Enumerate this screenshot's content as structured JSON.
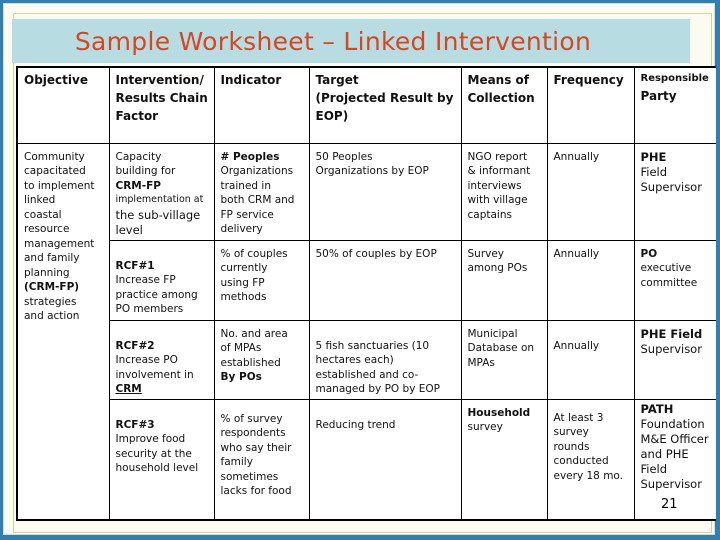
{
  "slide": {
    "title": "Sample Worksheet – Linked Intervention",
    "page_number": "21"
  },
  "table": {
    "headers": {
      "objective": "Objective",
      "intervention_l1": "Intervention/",
      "intervention_l2": "Results Chain",
      "intervention_l3": "Factor",
      "indicator": "Indicator",
      "target_l1": "Target",
      "target_l2": "(Projected Result  by",
      "target_l3": "EOP)",
      "means_l1": "Means of",
      "means_l2": "Collection",
      "frequency": "Frequency",
      "responsible_l1": "Responsible",
      "responsible_l2": "Party"
    },
    "objective": {
      "l1": "Community",
      "l2": "capacitated",
      "l3": "to implement",
      "l4": "linked",
      "l5": "coastal",
      "l6": "resource",
      "l7": "management",
      "l8": "and family",
      "l9": "planning",
      "l10": "(CRM-FP)",
      "l11": "strategies",
      "l12": "and action"
    },
    "rows": [
      {
        "intervention": {
          "l1": "Capacity",
          "l2": "building for",
          "l3": "CRM-FP",
          "l4": "implementation at",
          "l5": "the sub-village",
          "l6": "level"
        },
        "indicator": {
          "l1": "# Peoples",
          "l2": "Organizations",
          "l3": "trained in",
          "l4": "both CRM and",
          "l5": "FP service",
          "l6": "delivery"
        },
        "target": {
          "l1": "50 Peoples",
          "l2": "Organizations by EOP"
        },
        "means": {
          "l1": "NGO report",
          "l2": "& informant",
          "l3": "interviews",
          "l4": "with village",
          "l5": "captains"
        },
        "frequency": {
          "l1": "Annually"
        },
        "responsible": {
          "l1": "PHE",
          "l2": "Field",
          "l3": "Supervisor"
        }
      },
      {
        "intervention": {
          "l1": "RCF#1",
          "l2": "Increase FP",
          "l3": "practice among",
          "l4": "PO members"
        },
        "indicator": {
          "l1": "% of couples",
          "l2": "currently",
          "l3": "using FP",
          "l4": "methods"
        },
        "target": {
          "l1": "50% of couples by EOP"
        },
        "means": {
          "l1": "Survey",
          "l2": "among POs"
        },
        "frequency": {
          "l1": "Annually"
        },
        "responsible": {
          "l1": "PO",
          "l2": "executive",
          "l3": "committee"
        }
      },
      {
        "intervention": {
          "l1": "RCF#2",
          "l2": "Increase PO",
          "l3": "involvement in",
          "l4": "CRM"
        },
        "indicator": {
          "l1": "No. and area",
          "l2": "of MPAs",
          "l3": "established",
          "l4": "By POs"
        },
        "target": {
          "l1": "5 fish sanctuaries (10",
          "l2": "hectares each)",
          "l3": "established and co-",
          "l4": "managed by PO by EOP"
        },
        "means": {
          "l1": "Municipal",
          "l2": "Database on",
          "l3": "MPAs"
        },
        "frequency": {
          "l1": "Annually"
        },
        "responsible": {
          "l1": "PHE Field",
          "l2": "Supervisor"
        }
      },
      {
        "intervention": {
          "l1": "RCF#3",
          "l2": "Improve food",
          "l3": "security at the",
          "l4": "household level"
        },
        "indicator": {
          "l1": "% of survey",
          "l2": "respondents",
          "l3": "who say their",
          "l4": "family",
          "l5": "sometimes",
          "l6": "lacks for food"
        },
        "target": {
          "l1": "Reducing trend"
        },
        "means": {
          "l1": "Household",
          "l2": "survey"
        },
        "frequency": {
          "l1": "At least 3",
          "l2": "survey",
          "l3": "rounds",
          "l4": "conducted",
          "l5": "every 18 mo."
        },
        "responsible": {
          "l1": "PATH",
          "l2": "Foundation",
          "l3": "M&E Officer",
          "l4": "and PHE",
          "l5": "Field",
          "l6": "Supervisor"
        }
      }
    ]
  }
}
